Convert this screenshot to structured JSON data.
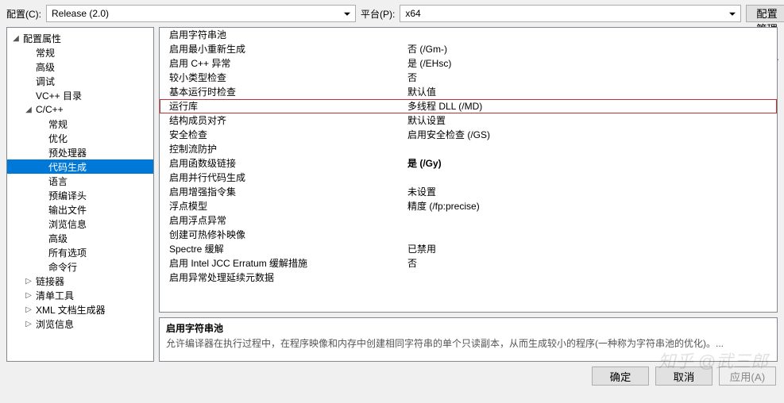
{
  "topbar": {
    "config_label": "配置(C):",
    "config_value": "Release (2.0)",
    "platform_label": "平台(P):",
    "platform_value": "x64",
    "manager_button": "配置管理器(O)..."
  },
  "tree": {
    "root": "配置属性",
    "items": [
      {
        "label": "常规",
        "indent": 2,
        "glyph": ""
      },
      {
        "label": "高级",
        "indent": 2,
        "glyph": ""
      },
      {
        "label": "调试",
        "indent": 2,
        "glyph": ""
      },
      {
        "label": "VC++ 目录",
        "indent": 2,
        "glyph": ""
      },
      {
        "label": "C/C++",
        "indent": 2,
        "glyph": "◢",
        "expandable": true
      },
      {
        "label": "常规",
        "indent": 3,
        "glyph": ""
      },
      {
        "label": "优化",
        "indent": 3,
        "glyph": ""
      },
      {
        "label": "预处理器",
        "indent": 3,
        "glyph": ""
      },
      {
        "label": "代码生成",
        "indent": 3,
        "glyph": "",
        "selected": true
      },
      {
        "label": "语言",
        "indent": 3,
        "glyph": ""
      },
      {
        "label": "预编译头",
        "indent": 3,
        "glyph": ""
      },
      {
        "label": "输出文件",
        "indent": 3,
        "glyph": ""
      },
      {
        "label": "浏览信息",
        "indent": 3,
        "glyph": ""
      },
      {
        "label": "高级",
        "indent": 3,
        "glyph": ""
      },
      {
        "label": "所有选项",
        "indent": 3,
        "glyph": ""
      },
      {
        "label": "命令行",
        "indent": 3,
        "glyph": ""
      },
      {
        "label": "链接器",
        "indent": 2,
        "glyph": "▷",
        "expandable": true
      },
      {
        "label": "清单工具",
        "indent": 2,
        "glyph": "▷",
        "expandable": true
      },
      {
        "label": "XML 文档生成器",
        "indent": 2,
        "glyph": "▷",
        "expandable": true
      },
      {
        "label": "浏览信息",
        "indent": 2,
        "glyph": "▷",
        "expandable": true
      }
    ]
  },
  "grid": [
    {
      "label": "启用字符串池",
      "value": ""
    },
    {
      "label": "启用最小重新生成",
      "value": "否 (/Gm-)"
    },
    {
      "label": "启用 C++ 异常",
      "value": "是 (/EHsc)"
    },
    {
      "label": "较小类型检查",
      "value": "否"
    },
    {
      "label": "基本运行时检查",
      "value": "默认值"
    },
    {
      "label": "运行库",
      "value": "多线程 DLL (/MD)",
      "highlight": true
    },
    {
      "label": "结构成员对齐",
      "value": "默认设置"
    },
    {
      "label": "安全检查",
      "value": "启用安全检查 (/GS)"
    },
    {
      "label": "控制流防护",
      "value": ""
    },
    {
      "label": "启用函数级链接",
      "value": "是 (/Gy)",
      "bold": true
    },
    {
      "label": "启用并行代码生成",
      "value": ""
    },
    {
      "label": "启用增强指令集",
      "value": "未设置"
    },
    {
      "label": "浮点模型",
      "value": "精度 (/fp:precise)"
    },
    {
      "label": "启用浮点异常",
      "value": ""
    },
    {
      "label": "创建可热修补映像",
      "value": ""
    },
    {
      "label": "Spectre 缓解",
      "value": "已禁用"
    },
    {
      "label": "启用 Intel JCC Erratum 缓解措施",
      "value": "否"
    },
    {
      "label": "启用异常处理延续元数据",
      "value": ""
    }
  ],
  "description": {
    "title": "启用字符串池",
    "text": "允许编译器在执行过程中，在程序映像和内存中创建相同字符串的单个只读副本，从而生成较小的程序(一种称为字符串池的优化)。..."
  },
  "buttons": {
    "ok": "确定",
    "cancel": "取消",
    "apply": "应用(A)"
  },
  "watermark": "知乎 @武三郎"
}
